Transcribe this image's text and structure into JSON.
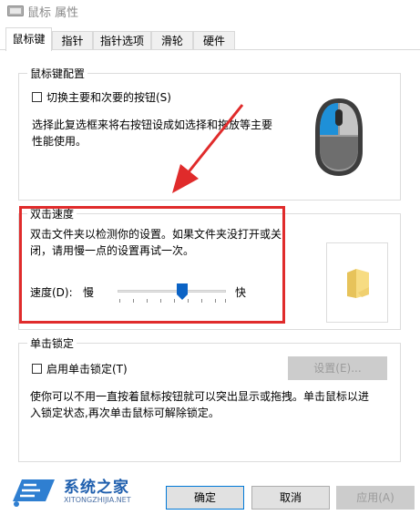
{
  "window": {
    "title": "鼠标 属性"
  },
  "tabs": [
    {
      "label": "鼠标键",
      "active": true
    },
    {
      "label": "指针"
    },
    {
      "label": "指针选项"
    },
    {
      "label": "滑轮"
    },
    {
      "label": "硬件"
    }
  ],
  "button_config": {
    "title": "鼠标键配置",
    "switch_checkbox_label": "切换主要和次要的按钮(S)",
    "switch_checked": false,
    "description_line1": "选择此复选框来将右按钮设成如选择和拖放等主要",
    "description_line2": "性能使用。"
  },
  "double_click": {
    "title": "双击速度",
    "description_line1": "双击文件夹以检测你的设置。如果文件夹没打开或关",
    "description_line2": "闭，请用慢一点的设置再试一次。",
    "speed_label": "速度(D):",
    "slow_label": "慢",
    "fast_label": "快",
    "speed_value": 0.6
  },
  "click_lock": {
    "title": "单击锁定",
    "enable_checkbox_label": "启用单击锁定(T)",
    "enable_checked": false,
    "settings_button": "设置(E)...",
    "description_line1": "使你可以不用一直按着鼠标按钮就可以突出显示或拖拽。单击鼠标以进",
    "description_line2": "入锁定状态,再次单击鼠标可解除锁定。"
  },
  "footer": {
    "ok": "确定",
    "cancel": "取消",
    "apply": "应用(A)"
  },
  "watermark": {
    "cn": "系统之家",
    "en": "XITONGZHIJIA.NET"
  },
  "colors": {
    "annotation_red": "#e02b2b",
    "slider_thumb": "#0b63c5",
    "mouse_accent": "#1e90d8"
  }
}
